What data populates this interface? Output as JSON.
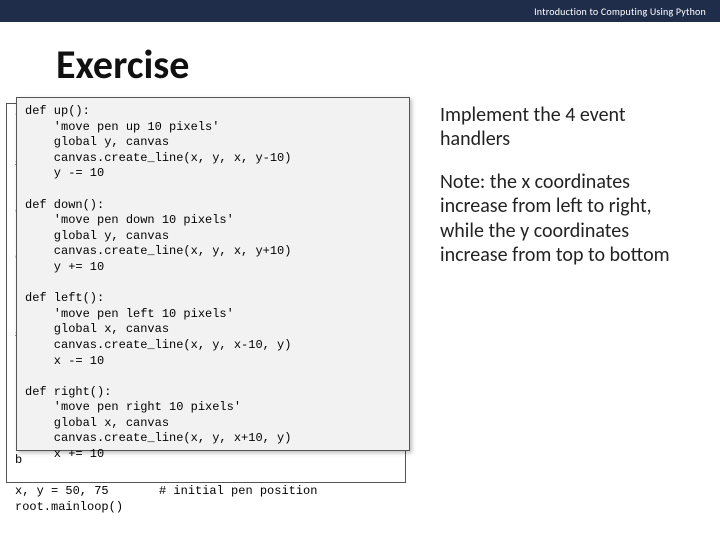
{
  "header": {
    "course": "Introduction to Computing Using Python"
  },
  "title": "Exercise",
  "body": {
    "p1": "Implement the 4 event handlers",
    "p2": "Note: the x coordinates increase from left to right, while the y coordinates increase from top to bottom"
  },
  "code": {
    "background": "f\ns\n\n#\n\nr\nc\n\n\nc\n\nb\nb\n\n#\nb\nb\nb\nb\nb\nb\nb\nb\n\nx, y = 50, 75       # initial pen position\nroot.mainloop()",
    "foreground": "def up():\n    'move pen up 10 pixels'\n    global y, canvas\n    canvas.create_line(x, y, x, y-10)\n    y -= 10\n\ndef down():\n    'move pen down 10 pixels'\n    global y, canvas\n    canvas.create_line(x, y, x, y+10)\n    y += 10\n\ndef left():\n    'move pen left 10 pixels'\n    global x, canvas\n    canvas.create_line(x, y, x-10, y)\n    x -= 10\n\ndef right():\n    'move pen right 10 pixels'\n    global x, canvas\n    canvas.create_line(x, y, x+10, y)\n    x += 10"
  }
}
